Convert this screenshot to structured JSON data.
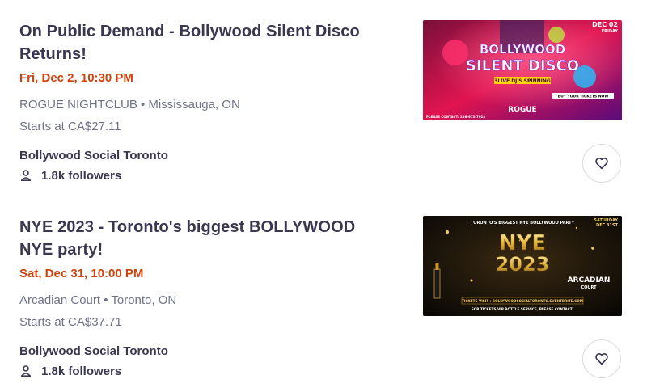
{
  "events": [
    {
      "title": "On Public Demand - Bollywood Silent Disco Returns!",
      "date": "Fri, Dec 2, 10:30 PM",
      "venue": "ROGUE NIGHTCLUB • Mississauga, ON",
      "price": "Starts at CA$27.11",
      "organizer": "Bollywood Social Toronto",
      "followers": "1.8k followers",
      "image": {
        "headline_top": "BOLLYWOOD",
        "headline_bottom": "SILENT DISCO",
        "badge": "3LIVE DJ'S SPINNING",
        "date_line1": "DEC 02",
        "date_line2": "FRIDAY",
        "buy": "BUY YOUR TICKETS NOW",
        "venue_logo": "ROGUE",
        "contact": "PLEASE CONTACT: 226-973-7923"
      }
    },
    {
      "title": "NYE 2023 - Toronto's biggest BOLLYWOOD NYE party!",
      "date": "Sat, Dec 31, 10:00 PM",
      "venue": "Arcadian Court • Toronto, ON",
      "price": "Starts at CA$37.71",
      "organizer": "Bollywood Social Toronto",
      "followers": "1.8k followers",
      "image": {
        "top_line": "TORONTO'S BIGGEST NYE BOLLYWOOD PARTY",
        "headline": "NYE",
        "year": "2023",
        "date_line1": "SATURDAY",
        "date_line2": "DEC 31ST",
        "venue_logo": "ARCADIAN",
        "venue_logo_sub": "COURT",
        "tickets": "TICKETS VISIT : BOLLYWOODSOCIALTORONTO.EVENTBRITE.COM",
        "contact": "FOR TICKETS/VIP BOTTLE SERVICE, PLEASE CONTACT:"
      }
    }
  ],
  "colors": {
    "title": "#39364f",
    "date": "#d1410c",
    "meta": "#6f7287",
    "border": "#dbdae3"
  },
  "icons": {
    "follower": "person-icon",
    "save": "heart-icon"
  }
}
